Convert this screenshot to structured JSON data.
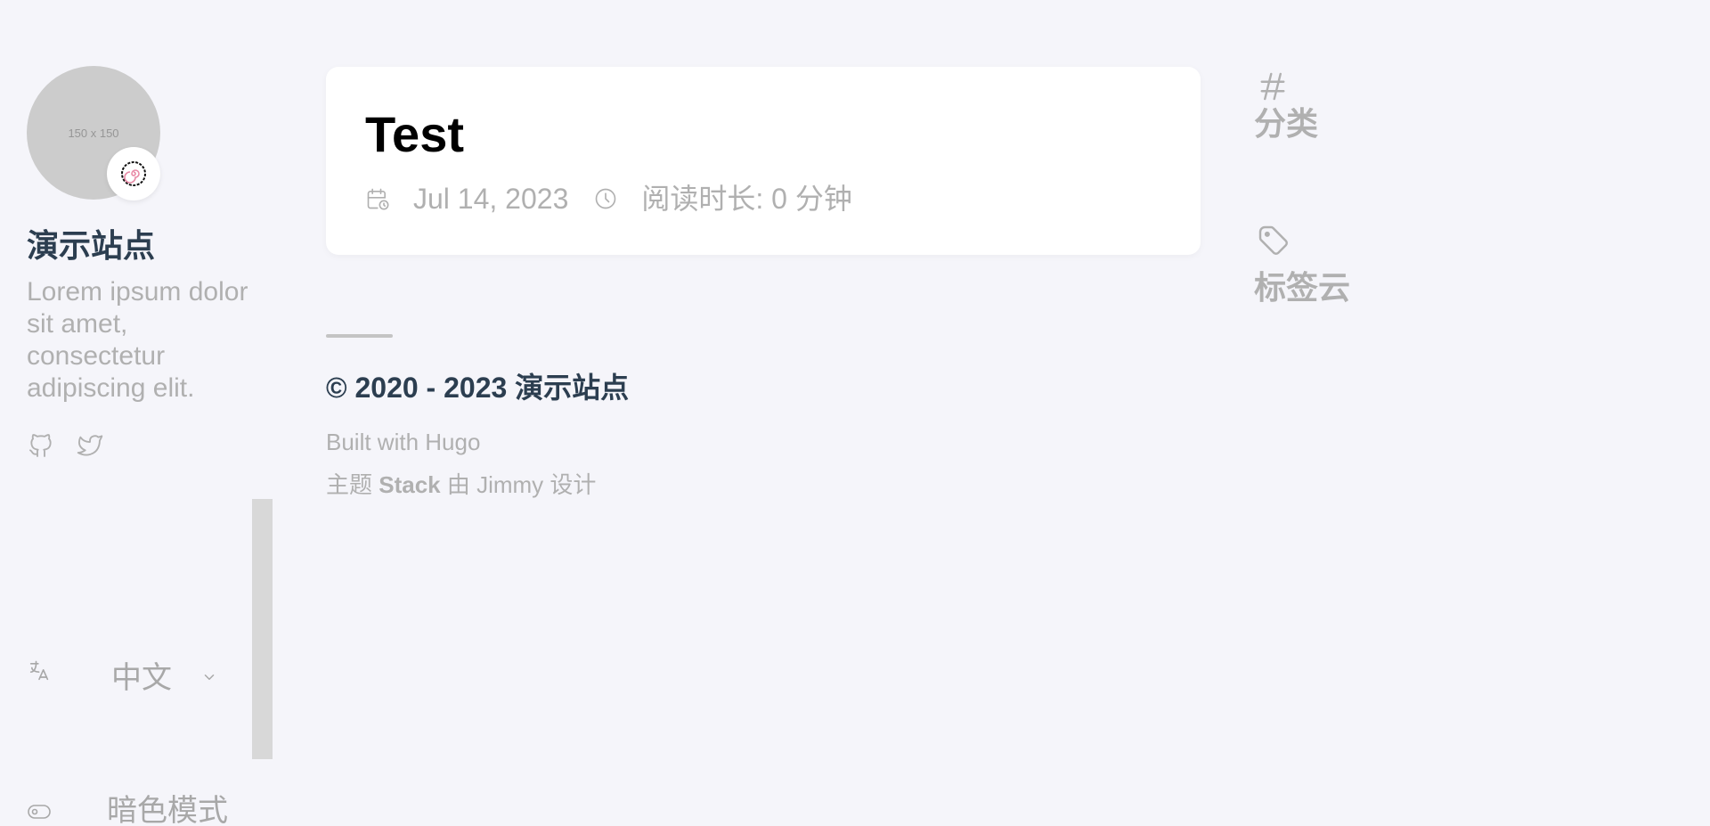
{
  "sidebar": {
    "avatar_text": "150 x 150",
    "site_name": "演示站点",
    "site_description": "Lorem ipsum dolor sit amet, consectetur adipiscing elit.",
    "social_icons": [
      "github-icon",
      "twitter-icon"
    ],
    "language_label": "中文",
    "dark_mode_label": "暗色模式"
  },
  "post": {
    "title": "Test",
    "date": "Jul 14, 2023",
    "reading_time": "阅读时长: 0 分钟"
  },
  "footer": {
    "copyright_prefix": "© 2020 - 2023 ",
    "copyright_site": "演示站点",
    "built_with": "Built with Hugo",
    "theme_prefix": "主题 ",
    "theme_name": "Stack",
    "theme_suffix": " 由 Jimmy 设计"
  },
  "widgets": {
    "categories_label": "分类",
    "tags_label": "标签云"
  },
  "colors": {
    "background": "#f5f5fa",
    "heading": "#2c3e50",
    "muted": "#b0b0b0",
    "card": "#ffffff"
  }
}
